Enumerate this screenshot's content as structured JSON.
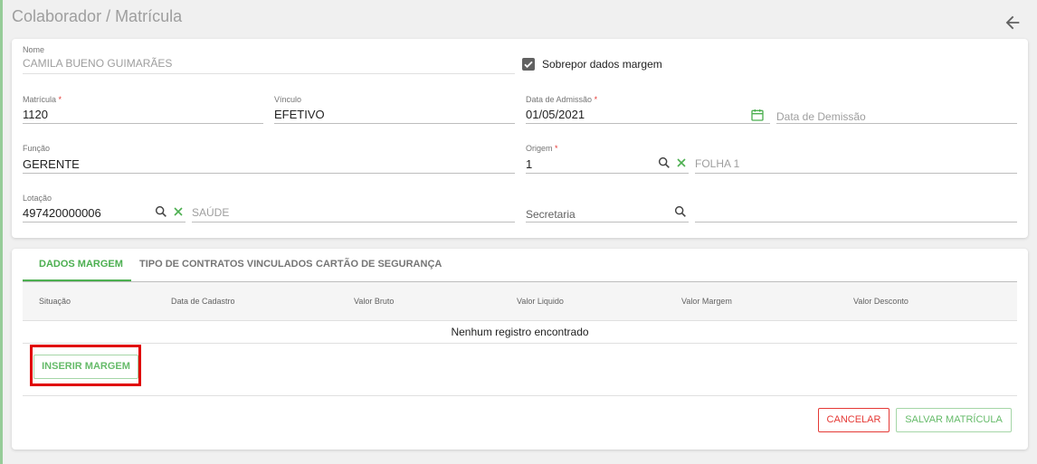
{
  "header": {
    "title": "Colaborador / Matrícula",
    "back_icon": "arrow-left-icon"
  },
  "form": {
    "nome": {
      "label": "Nome",
      "value": "CAMILA BUENO GUIMARÃES"
    },
    "sobrepor": {
      "label": "Sobrepor dados margem",
      "checked": true
    },
    "matricula": {
      "label": "Matrícula",
      "required": "*",
      "value": "1120"
    },
    "vinculo": {
      "label": "Vínculo",
      "value": "EFETIVO"
    },
    "admissao": {
      "label": "Data de Admissão",
      "required": "*",
      "value": "01/05/2021"
    },
    "demissao": {
      "placeholder": "Data de Demissão"
    },
    "funcao": {
      "label": "Função",
      "value": "GERENTE"
    },
    "origem": {
      "label": "Origem",
      "required": "*",
      "value": "1",
      "description": "FOLHA 1"
    },
    "lotacao": {
      "label": "Lotação",
      "value": "497420000006",
      "description": "SAÚDE"
    },
    "secretaria": {
      "placeholder": "Secretaria"
    }
  },
  "tabs": [
    {
      "label": "DADOS MARGEM",
      "active": true
    },
    {
      "label": "TIPO DE CONTRATOS VINCULADOS",
      "active": false
    },
    {
      "label": "CARTÃO DE SEGURANÇA",
      "active": false
    }
  ],
  "table": {
    "columns": [
      "Situação",
      "Data de Cadastro",
      "Valor Bruto",
      "Valor Liquido",
      "Valor Margem",
      "Valor Desconto"
    ],
    "empty_text": "Nenhum registro encontrado"
  },
  "actions": {
    "insert": "INSERIR MARGEM",
    "cancel": "CANCELAR",
    "save": "SALVAR MATRÍCULA"
  },
  "colors": {
    "accent": "#4caf50",
    "danger": "#e53935",
    "highlight": "#e00000"
  }
}
